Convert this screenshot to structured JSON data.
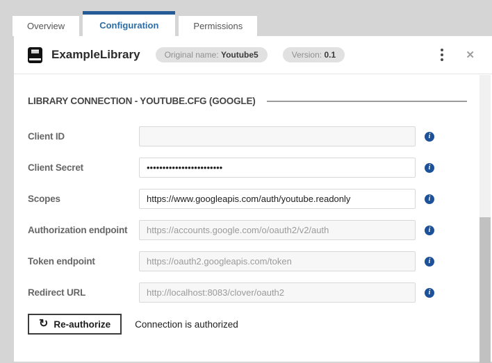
{
  "tabs": [
    {
      "label": "Overview",
      "active": false
    },
    {
      "label": "Configuration",
      "active": true
    },
    {
      "label": "Permissions",
      "active": false
    }
  ],
  "header": {
    "title": "ExampleLibrary",
    "badges": [
      {
        "label": "Original name:",
        "value": "Youtube5"
      },
      {
        "label": "Version:",
        "value": "0.1"
      }
    ]
  },
  "section": {
    "title": "LIBRARY CONNECTION - YOUTUBE.CFG (GOOGLE)"
  },
  "fields": [
    {
      "name": "client-id",
      "label": "Client ID",
      "value": "",
      "state": "readonly"
    },
    {
      "name": "client-secret",
      "label": "Client Secret",
      "value": "••••••••••••••••••••••••",
      "state": "editable"
    },
    {
      "name": "scopes",
      "label": "Scopes",
      "value": "https://www.googleapis.com/auth/youtube.readonly",
      "state": "editable"
    },
    {
      "name": "authorization-endpoint",
      "label": "Authorization endpoint",
      "value": "https://accounts.google.com/o/oauth2/v2/auth",
      "state": "readonly"
    },
    {
      "name": "token-endpoint",
      "label": "Token endpoint",
      "value": "https://oauth2.googleapis.com/token",
      "state": "readonly"
    },
    {
      "name": "redirect-url",
      "label": "Redirect URL",
      "value": "http://localhost:8083/clover/oauth2",
      "state": "readonly"
    }
  ],
  "footer": {
    "button_label": "Re-authorize",
    "status_text": "Connection is authorized"
  },
  "icons": {
    "close": "✕",
    "refresh": "↻",
    "info": "i"
  },
  "colors": {
    "accent_blue": "#255c97",
    "active_tab_text": "#2e6da4",
    "info_icon_bg": "#1d5199",
    "page_background": "#d5d5d5"
  }
}
